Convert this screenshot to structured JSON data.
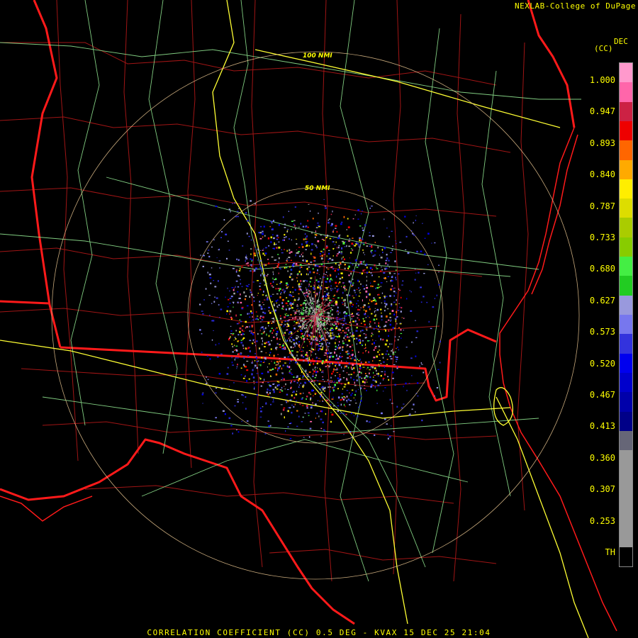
{
  "header": {
    "source": "NEXLAB-College of DuPage"
  },
  "colorbar": {
    "unit_abbr": "DEC",
    "unit": "(CC)",
    "ticks": [
      "1.000",
      "0.947",
      "0.893",
      "0.840",
      "0.787",
      "0.733",
      "0.680",
      "0.627",
      "0.573",
      "0.520",
      "0.467",
      "0.413",
      "0.360",
      "0.307",
      "0.253",
      "TH"
    ],
    "colors": [
      "#ff99cc",
      "#ff66aa",
      "#cc2244",
      "#ee0000",
      "#ff6600",
      "#ffaa00",
      "#ffee00",
      "#dddd00",
      "#aacc00",
      "#88cc00",
      "#44ee44",
      "#22cc22",
      "#9999dd",
      "#7777ee",
      "#3333dd",
      "#0000ee",
      "#0000cc",
      "#0000aa",
      "#000088",
      "#666677",
      "#999999",
      "#999999",
      "#999999",
      "#999999",
      "#999999",
      "#000000"
    ]
  },
  "rings": [
    {
      "label": "50 NMI"
    },
    {
      "label": "100 NMI"
    }
  ],
  "footer": {
    "title": "CORRELATION COEFFICIENT (CC) 0.5 DEG - KVAX 15 DEC 25 21:04"
  },
  "colors": {
    "state_border": "#ff1a1a",
    "county": "#b01818",
    "highway": "#ffff33",
    "road": "#8fe38f",
    "ring": "#e8c48f",
    "label": "#ffff00"
  }
}
